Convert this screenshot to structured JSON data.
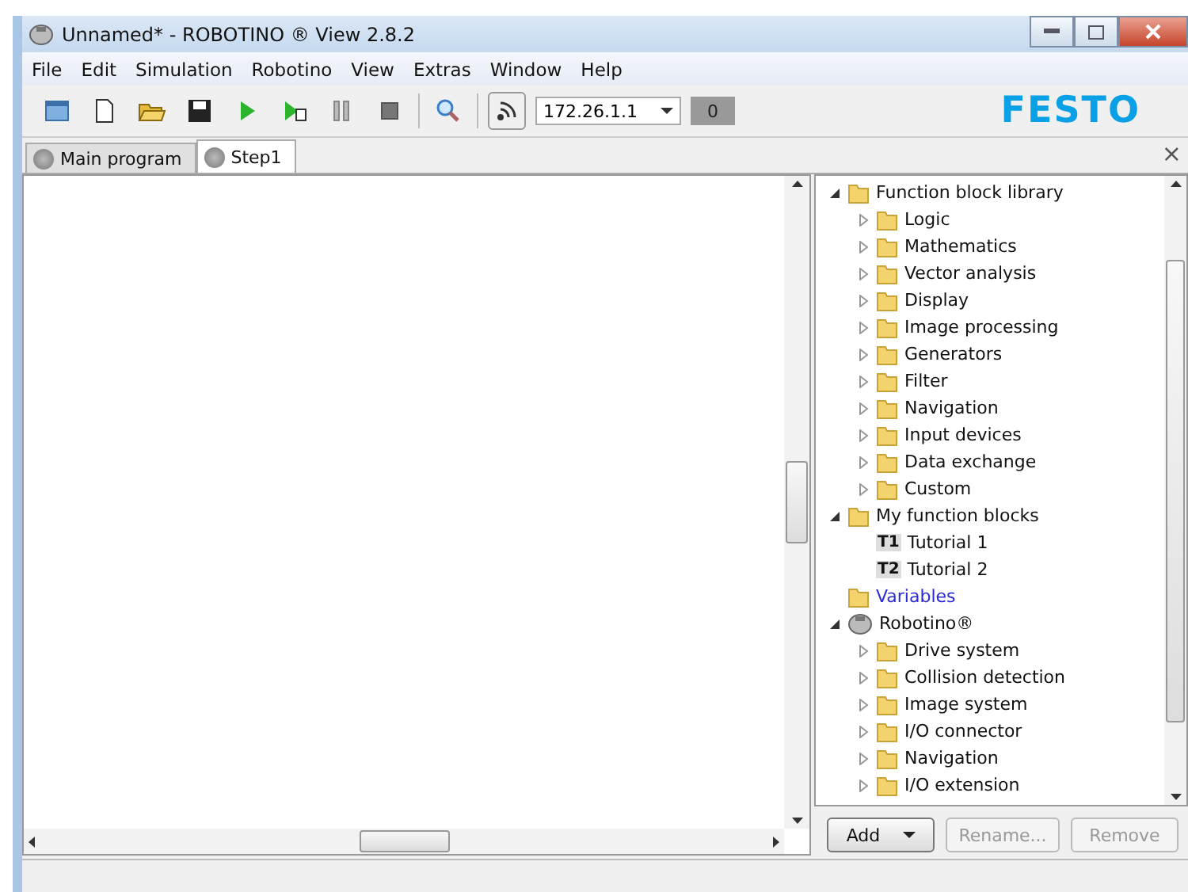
{
  "window": {
    "title": "Unnamed* - ROBOTINO ® View 2.8.2"
  },
  "menu": [
    "File",
    "Edit",
    "Simulation",
    "Robotino",
    "View",
    "Extras",
    "Window",
    "Help"
  ],
  "toolbar": {
    "address": "172.26.1.1",
    "counter": "0",
    "logo": "FESTO"
  },
  "tabs": [
    {
      "label": "Main program",
      "selected": false
    },
    {
      "label": "Step1",
      "selected": true
    }
  ],
  "tab_close": "×",
  "tree": [
    {
      "label": "Function block library",
      "kind": "folder",
      "expanded": true,
      "children": [
        {
          "label": "Logic",
          "kind": "folder",
          "expanded": false
        },
        {
          "label": "Mathematics",
          "kind": "folder",
          "expanded": false
        },
        {
          "label": "Vector analysis",
          "kind": "folder",
          "expanded": false
        },
        {
          "label": "Display",
          "kind": "folder",
          "expanded": false
        },
        {
          "label": "Image processing",
          "kind": "folder",
          "expanded": false
        },
        {
          "label": "Generators",
          "kind": "folder",
          "expanded": false
        },
        {
          "label": "Filter",
          "kind": "folder",
          "expanded": false
        },
        {
          "label": "Navigation",
          "kind": "folder",
          "expanded": false
        },
        {
          "label": "Input devices",
          "kind": "folder",
          "expanded": false
        },
        {
          "label": "Data exchange",
          "kind": "folder",
          "expanded": false
        },
        {
          "label": "Custom",
          "kind": "folder",
          "expanded": false
        }
      ]
    },
    {
      "label": "My function blocks",
      "kind": "folder",
      "expanded": true,
      "children": [
        {
          "label": "Tutorial 1",
          "kind": "block",
          "badge": "T1"
        },
        {
          "label": "Tutorial 2",
          "kind": "block",
          "badge": "T2"
        }
      ]
    },
    {
      "label": "Variables",
      "kind": "variables"
    },
    {
      "label": "Robotino®",
      "kind": "robot",
      "expanded": true,
      "children": [
        {
          "label": "Drive system",
          "kind": "folder",
          "expanded": false
        },
        {
          "label": "Collision detection",
          "kind": "folder",
          "expanded": false
        },
        {
          "label": "Image system",
          "kind": "folder",
          "expanded": false
        },
        {
          "label": "I/O connector",
          "kind": "folder",
          "expanded": false
        },
        {
          "label": "Navigation",
          "kind": "folder",
          "expanded": false
        },
        {
          "label": "I/O extension",
          "kind": "folder",
          "expanded": false
        }
      ]
    }
  ],
  "buttons": [
    {
      "label": "Add",
      "disabled": false,
      "dropdown": true
    },
    {
      "label": "Rename...",
      "disabled": true,
      "dropdown": false
    },
    {
      "label": "Remove",
      "disabled": true,
      "dropdown": false
    }
  ]
}
